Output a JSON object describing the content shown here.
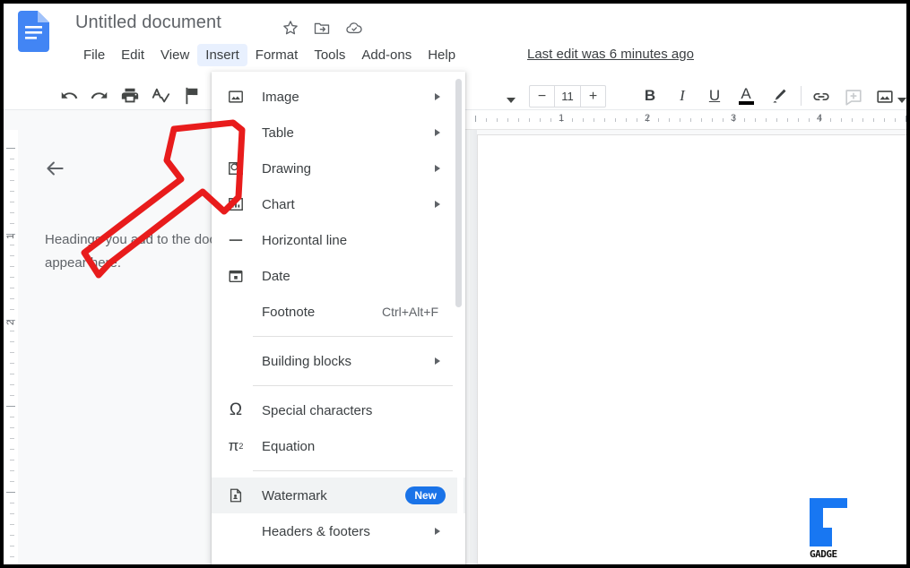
{
  "app": {
    "name": "Google Docs",
    "logo_icon": "docs-file-icon"
  },
  "header": {
    "doc_title": "Untitled document",
    "icons": [
      {
        "name": "star-icon",
        "label": "Star"
      },
      {
        "name": "move-to-folder-icon",
        "label": "Move to folder"
      },
      {
        "name": "cloud-saved-icon",
        "label": "Document status"
      }
    ],
    "menus": [
      {
        "label": "File",
        "active": false
      },
      {
        "label": "Edit",
        "active": false
      },
      {
        "label": "View",
        "active": false
      },
      {
        "label": "Insert",
        "active": true
      },
      {
        "label": "Format",
        "active": false
      },
      {
        "label": "Tools",
        "active": false
      },
      {
        "label": "Add-ons",
        "active": false
      },
      {
        "label": "Help",
        "active": false
      }
    ],
    "last_edit": "Last edit was 6 minutes ago"
  },
  "toolbar": {
    "left_icons": [
      {
        "name": "undo-icon",
        "label": "Undo"
      },
      {
        "name": "redo-icon",
        "label": "Redo"
      },
      {
        "name": "print-icon",
        "label": "Print"
      },
      {
        "name": "spelling-check-icon",
        "label": "Spelling and grammar check"
      },
      {
        "name": "paint-format-icon",
        "label": "Paint format"
      }
    ],
    "font_dropdown_caret": "chevron-down-icon",
    "font_size_decrease": "−",
    "font_size": "11",
    "font_size_increase": "+",
    "bold": "B",
    "italic": "I",
    "underline": "U",
    "text_color": "A",
    "highlight": "highlight-pen-icon",
    "insert_link": "link-icon",
    "add_comment": "add-comment-icon",
    "insert_image": "insert-image-icon",
    "image_caret": "chevron-down-icon"
  },
  "ruler": {
    "horizontal_numbers": [
      "1",
      "2",
      "3",
      "4"
    ],
    "vertical_numbers": [
      "1",
      "2"
    ]
  },
  "outline": {
    "back_icon": "arrow-left-icon",
    "empty_text": "Headings you add to the document will appear here."
  },
  "insert_menu": {
    "items": [
      {
        "icon": "image-icon",
        "label": "Image",
        "shortcut": "",
        "submenu": true,
        "badge": "",
        "highlight": false
      },
      {
        "icon": "table-icon",
        "label": "Table",
        "shortcut": "",
        "submenu": true,
        "badge": "",
        "highlight": false
      },
      {
        "icon": "drawing-icon",
        "label": "Drawing",
        "shortcut": "",
        "submenu": true,
        "badge": "",
        "highlight": false
      },
      {
        "icon": "chart-icon",
        "label": "Chart",
        "shortcut": "",
        "submenu": true,
        "badge": "",
        "highlight": false
      },
      {
        "icon": "horizontal-line-icon",
        "label": "Horizontal line",
        "shortcut": "",
        "submenu": false,
        "badge": "",
        "highlight": false
      },
      {
        "icon": "date-icon",
        "label": "Date",
        "shortcut": "",
        "submenu": false,
        "badge": "",
        "highlight": false
      },
      {
        "icon": "",
        "label": "Footnote",
        "shortcut": "Ctrl+Alt+F",
        "submenu": false,
        "badge": "",
        "highlight": false
      },
      {
        "separator": true
      },
      {
        "icon": "",
        "label": "Building blocks",
        "shortcut": "",
        "submenu": true,
        "badge": "",
        "highlight": false
      },
      {
        "separator": true
      },
      {
        "icon": "omega-icon",
        "label": "Special characters",
        "shortcut": "",
        "submenu": false,
        "badge": "",
        "highlight": false
      },
      {
        "icon": "equation-icon",
        "label": "Equation",
        "shortcut": "",
        "submenu": false,
        "badge": "",
        "highlight": false
      },
      {
        "separator": true
      },
      {
        "icon": "watermark-icon",
        "label": "Watermark",
        "shortcut": "",
        "submenu": false,
        "badge": "New",
        "highlight": true
      },
      {
        "icon": "",
        "label": "Headers & footers",
        "shortcut": "",
        "submenu": true,
        "badge": "",
        "highlight": false
      }
    ]
  },
  "annotation": {
    "type": "hand-drawn-arrow",
    "color": "#e81c1c",
    "points_to": "Insert menu"
  },
  "watermark_logo": {
    "text": "GADGE",
    "color": "#1877f2"
  },
  "colors": {
    "accent": "#1a73e8",
    "menu_active_bg": "#e8f0fe",
    "text_primary": "#3c4043",
    "text_secondary": "#5f6368",
    "workspace_bg": "#f8f9fa",
    "annotation_red": "#e81c1c"
  }
}
